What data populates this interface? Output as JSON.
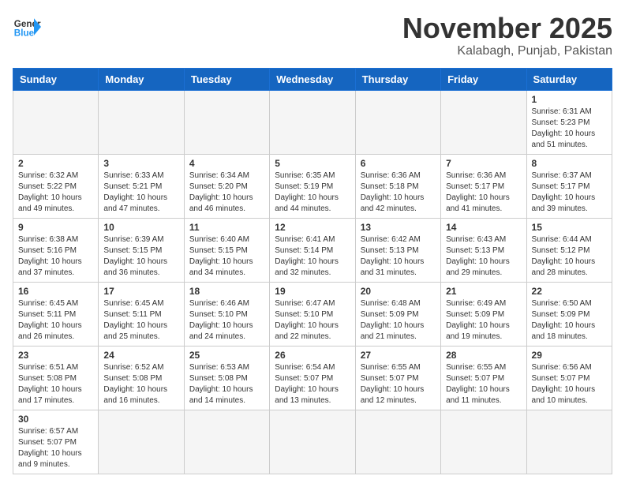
{
  "header": {
    "logo_general": "General",
    "logo_blue": "Blue",
    "month_title": "November 2025",
    "location": "Kalabagh, Punjab, Pakistan"
  },
  "weekdays": [
    "Sunday",
    "Monday",
    "Tuesday",
    "Wednesday",
    "Thursday",
    "Friday",
    "Saturday"
  ],
  "days": [
    {
      "num": "",
      "info": ""
    },
    {
      "num": "",
      "info": ""
    },
    {
      "num": "",
      "info": ""
    },
    {
      "num": "",
      "info": ""
    },
    {
      "num": "",
      "info": ""
    },
    {
      "num": "",
      "info": ""
    },
    {
      "num": "1",
      "info": "Sunrise: 6:31 AM\nSunset: 5:23 PM\nDaylight: 10 hours and 51 minutes."
    },
    {
      "num": "2",
      "info": "Sunrise: 6:32 AM\nSunset: 5:22 PM\nDaylight: 10 hours and 49 minutes."
    },
    {
      "num": "3",
      "info": "Sunrise: 6:33 AM\nSunset: 5:21 PM\nDaylight: 10 hours and 47 minutes."
    },
    {
      "num": "4",
      "info": "Sunrise: 6:34 AM\nSunset: 5:20 PM\nDaylight: 10 hours and 46 minutes."
    },
    {
      "num": "5",
      "info": "Sunrise: 6:35 AM\nSunset: 5:19 PM\nDaylight: 10 hours and 44 minutes."
    },
    {
      "num": "6",
      "info": "Sunrise: 6:36 AM\nSunset: 5:18 PM\nDaylight: 10 hours and 42 minutes."
    },
    {
      "num": "7",
      "info": "Sunrise: 6:36 AM\nSunset: 5:17 PM\nDaylight: 10 hours and 41 minutes."
    },
    {
      "num": "8",
      "info": "Sunrise: 6:37 AM\nSunset: 5:17 PM\nDaylight: 10 hours and 39 minutes."
    },
    {
      "num": "9",
      "info": "Sunrise: 6:38 AM\nSunset: 5:16 PM\nDaylight: 10 hours and 37 minutes."
    },
    {
      "num": "10",
      "info": "Sunrise: 6:39 AM\nSunset: 5:15 PM\nDaylight: 10 hours and 36 minutes."
    },
    {
      "num": "11",
      "info": "Sunrise: 6:40 AM\nSunset: 5:15 PM\nDaylight: 10 hours and 34 minutes."
    },
    {
      "num": "12",
      "info": "Sunrise: 6:41 AM\nSunset: 5:14 PM\nDaylight: 10 hours and 32 minutes."
    },
    {
      "num": "13",
      "info": "Sunrise: 6:42 AM\nSunset: 5:13 PM\nDaylight: 10 hours and 31 minutes."
    },
    {
      "num": "14",
      "info": "Sunrise: 6:43 AM\nSunset: 5:13 PM\nDaylight: 10 hours and 29 minutes."
    },
    {
      "num": "15",
      "info": "Sunrise: 6:44 AM\nSunset: 5:12 PM\nDaylight: 10 hours and 28 minutes."
    },
    {
      "num": "16",
      "info": "Sunrise: 6:45 AM\nSunset: 5:11 PM\nDaylight: 10 hours and 26 minutes."
    },
    {
      "num": "17",
      "info": "Sunrise: 6:45 AM\nSunset: 5:11 PM\nDaylight: 10 hours and 25 minutes."
    },
    {
      "num": "18",
      "info": "Sunrise: 6:46 AM\nSunset: 5:10 PM\nDaylight: 10 hours and 24 minutes."
    },
    {
      "num": "19",
      "info": "Sunrise: 6:47 AM\nSunset: 5:10 PM\nDaylight: 10 hours and 22 minutes."
    },
    {
      "num": "20",
      "info": "Sunrise: 6:48 AM\nSunset: 5:09 PM\nDaylight: 10 hours and 21 minutes."
    },
    {
      "num": "21",
      "info": "Sunrise: 6:49 AM\nSunset: 5:09 PM\nDaylight: 10 hours and 19 minutes."
    },
    {
      "num": "22",
      "info": "Sunrise: 6:50 AM\nSunset: 5:09 PM\nDaylight: 10 hours and 18 minutes."
    },
    {
      "num": "23",
      "info": "Sunrise: 6:51 AM\nSunset: 5:08 PM\nDaylight: 10 hours and 17 minutes."
    },
    {
      "num": "24",
      "info": "Sunrise: 6:52 AM\nSunset: 5:08 PM\nDaylight: 10 hours and 16 minutes."
    },
    {
      "num": "25",
      "info": "Sunrise: 6:53 AM\nSunset: 5:08 PM\nDaylight: 10 hours and 14 minutes."
    },
    {
      "num": "26",
      "info": "Sunrise: 6:54 AM\nSunset: 5:07 PM\nDaylight: 10 hours and 13 minutes."
    },
    {
      "num": "27",
      "info": "Sunrise: 6:55 AM\nSunset: 5:07 PM\nDaylight: 10 hours and 12 minutes."
    },
    {
      "num": "28",
      "info": "Sunrise: 6:55 AM\nSunset: 5:07 PM\nDaylight: 10 hours and 11 minutes."
    },
    {
      "num": "29",
      "info": "Sunrise: 6:56 AM\nSunset: 5:07 PM\nDaylight: 10 hours and 10 minutes."
    },
    {
      "num": "30",
      "info": "Sunrise: 6:57 AM\nSunset: 5:07 PM\nDaylight: 10 hours and 9 minutes."
    },
    {
      "num": "",
      "info": ""
    },
    {
      "num": "",
      "info": ""
    },
    {
      "num": "",
      "info": ""
    },
    {
      "num": "",
      "info": ""
    },
    {
      "num": "",
      "info": ""
    },
    {
      "num": "",
      "info": ""
    }
  ]
}
